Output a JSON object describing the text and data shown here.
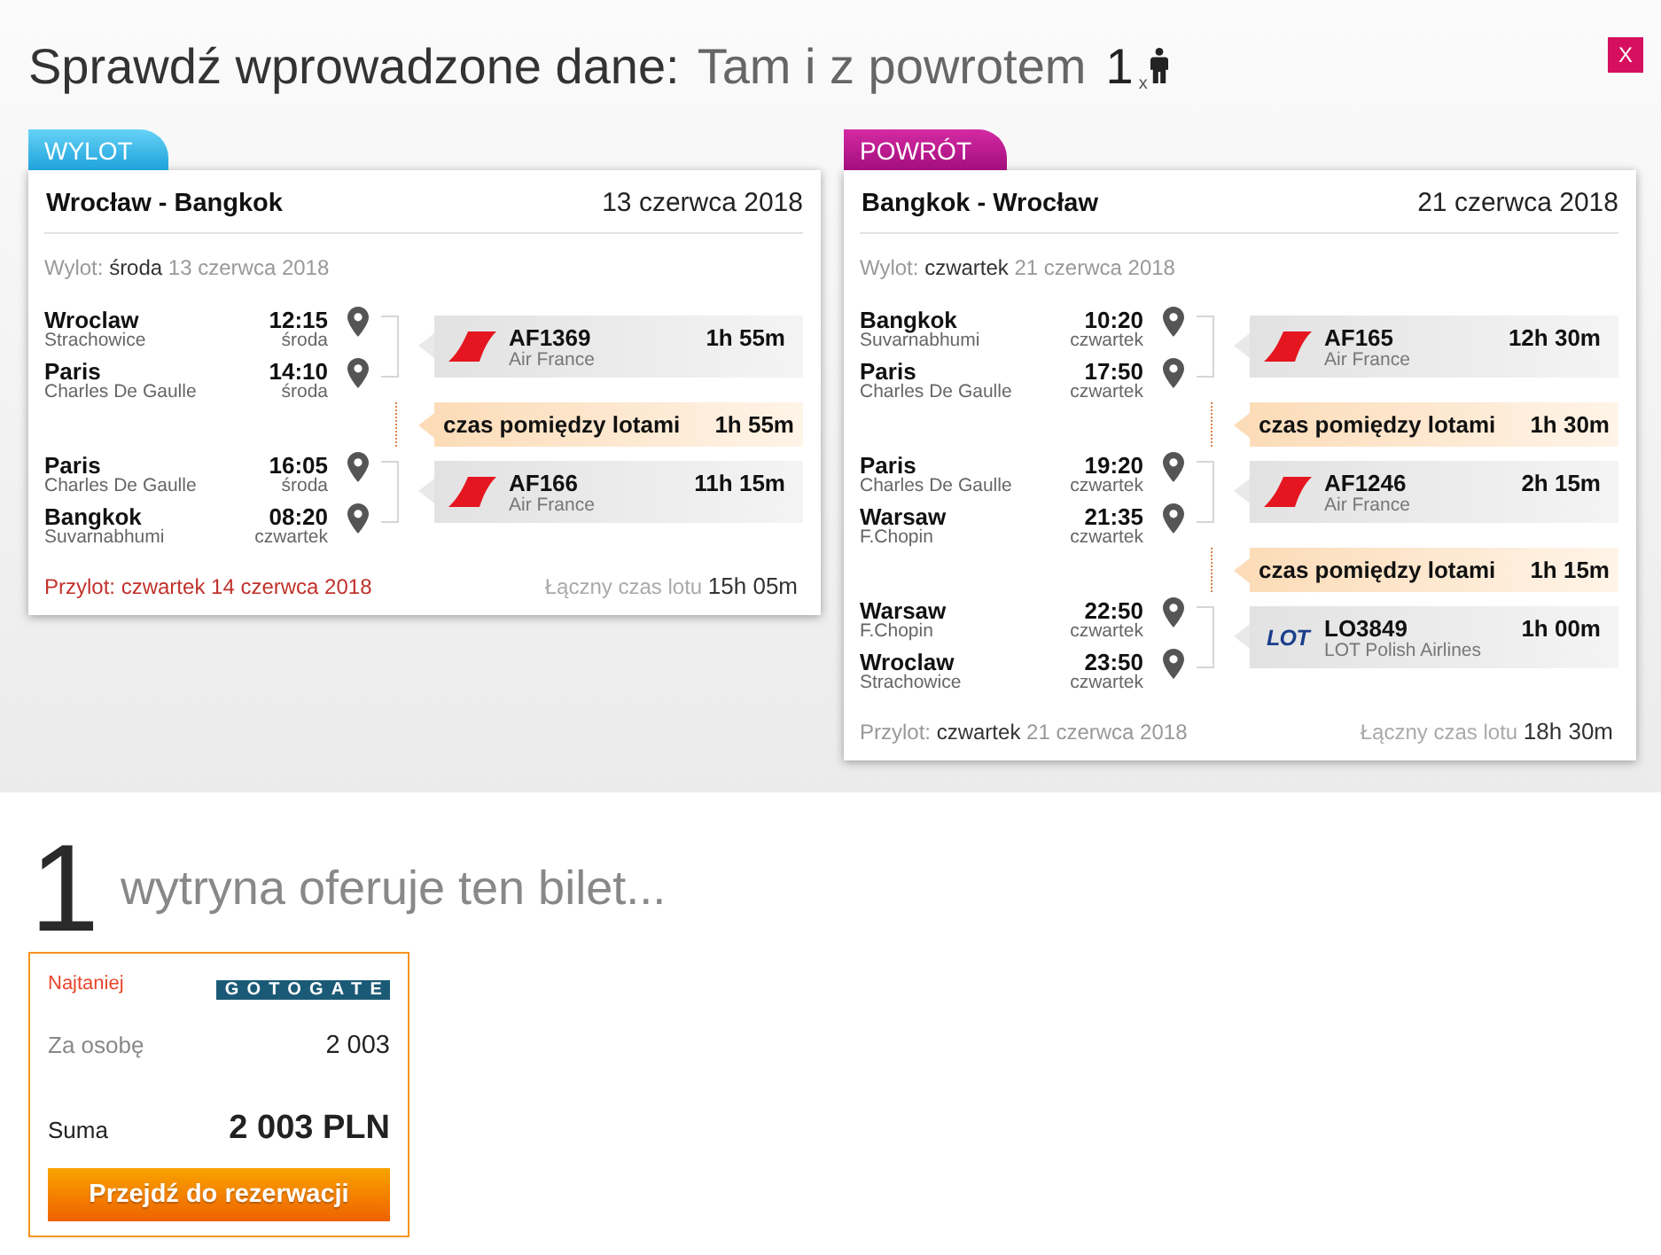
{
  "header": {
    "title": "Sprawdź wprowadzone dane:",
    "trip_type": "Tam i z powrotem",
    "passengers": "1$_{x}$"
  },
  "close_button": "X",
  "journeys": [
    {
      "tab": "WYLOT",
      "kind": "outbound",
      "route": "Wrocław - Bangkok",
      "date": "13 czerwca 2018",
      "departure": {
        "label": "Wylot:",
        "day": "środa",
        "date": "13 czerwca 2018"
      },
      "legs": [
        {
          "kind": "flight",
          "stops": [
            {
              "city": "Wroclaw",
              "airport": "Strachowice",
              "time": "12:15",
              "day": "środa"
            },
            {
              "city": "Paris",
              "airport": "Charles De Gaulle",
              "time": "14:10",
              "day": "środa"
            }
          ],
          "logo": {
            "kind": "slash"
          },
          "flight": "AF1369",
          "airline": "Air France",
          "duration": "1h 55m"
        },
        {
          "kind": "layover",
          "label": "czas pomiędzy lotami",
          "duration": "1h 55m"
        },
        {
          "kind": "flight",
          "stops": [
            {
              "city": "Paris",
              "airport": "Charles De Gaulle",
              "time": "16:05",
              "day": "środa"
            },
            {
              "city": "Bangkok",
              "airport": "Suvarnabhumi",
              "time": "08:20",
              "day": "czwartek"
            }
          ],
          "logo": {
            "kind": "slash"
          },
          "flight": "AF166",
          "airline": "Air France",
          "duration": "11h 15m"
        }
      ],
      "arrival": {
        "label": "Przylot:",
        "day": "czwartek",
        "date": "14 czerwca 2018",
        "warning": true
      },
      "total": {
        "label": "Łączny czas lotu",
        "value": "15h 05m"
      }
    },
    {
      "tab": "POWRÓT",
      "kind": "return",
      "route": "Bangkok - Wrocław",
      "date": "21 czerwca 2018",
      "departure": {
        "label": "Wylot:",
        "day": "czwartek",
        "date": "21 czerwca 2018"
      },
      "legs": [
        {
          "kind": "flight",
          "stops": [
            {
              "city": "Bangkok",
              "airport": "Suvarnabhumi",
              "time": "10:20",
              "day": "czwartek"
            },
            {
              "city": "Paris",
              "airport": "Charles De Gaulle",
              "time": "17:50",
              "day": "czwartek"
            }
          ],
          "logo": {
            "kind": "slash"
          },
          "flight": "AF165",
          "airline": "Air France",
          "duration": "12h 30m"
        },
        {
          "kind": "layover",
          "label": "czas pomiędzy lotami",
          "duration": "1h 30m"
        },
        {
          "kind": "flight",
          "stops": [
            {
              "city": "Paris",
              "airport": "Charles De Gaulle",
              "time": "19:20",
              "day": "czwartek"
            },
            {
              "city": "Warsaw",
              "airport": "F.Chopin",
              "time": "21:35",
              "day": "czwartek"
            }
          ],
          "logo": {
            "kind": "slash"
          },
          "flight": "AF1246",
          "airline": "Air France",
          "duration": "2h 15m"
        },
        {
          "kind": "layover",
          "label": "czas pomiędzy lotami",
          "duration": "1h 15m"
        },
        {
          "kind": "flight",
          "stops": [
            {
              "city": "Warsaw",
              "airport": "F.Chopin",
              "time": "22:50",
              "day": "czwartek"
            },
            {
              "city": "Wroclaw",
              "airport": "Strachowice",
              "time": "23:50",
              "day": "czwartek"
            }
          ],
          "logo": {
            "kind": "wordmark",
            "text": "LOT"
          },
          "flight": "LO3849",
          "airline": "LOT Polish Airlines",
          "duration": "1h 00m"
        }
      ],
      "arrival": {
        "label": "Przylot:",
        "day": "czwartek",
        "date": "21 czerwca 2018",
        "warning": false
      },
      "total": {
        "label": "Łączny czas lotu",
        "value": "18h 30m"
      }
    }
  ],
  "results_heading": {
    "count": "1",
    "text": "wytryna oferuje ten bilet..."
  },
  "offers": [
    {
      "badge": "Najtaniej",
      "provider": "GOTOGATE",
      "per_person_label": "Za osobę",
      "per_person": "2 003",
      "total_label": "Suma",
      "total": "2 003 PLN",
      "button": "Przejdź do rezerwacji"
    }
  ]
}
